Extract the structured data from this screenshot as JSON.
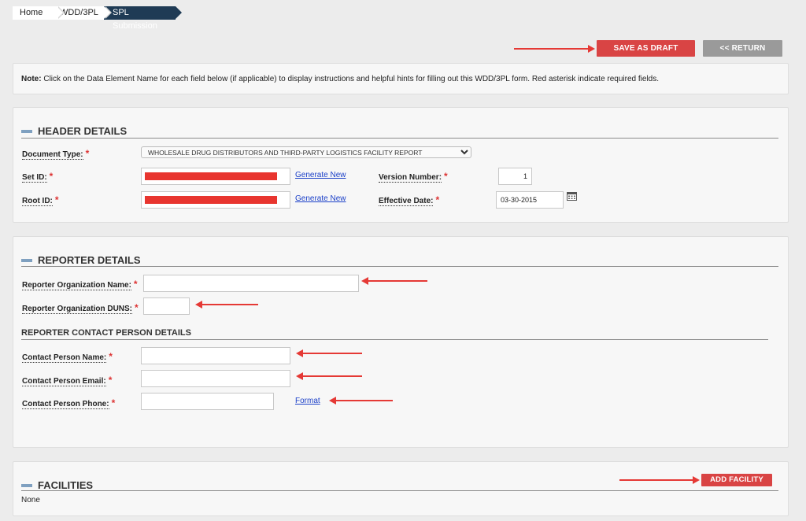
{
  "breadcrumb": [
    "Home",
    "WDD/3PL",
    "SPL Submission"
  ],
  "toolbar": {
    "save_draft": "SAVE AS DRAFT",
    "return": "<< RETURN"
  },
  "note": {
    "bold": "Note:",
    "text": " Click on the Data Element Name for each field below (if applicable) to display instructions and helpful hints for filling out this WDD/3PL form. Red asterisk indicate required fields."
  },
  "header_details": {
    "title": "HEADER DETAILS",
    "document_type_label": "Document Type:",
    "document_type_value": "WHOLESALE DRUG DISTRIBUTORS AND THIRD-PARTY LOGISTICS FACILITY REPORT",
    "set_id_label": "Set ID:",
    "root_id_label": "Root ID:",
    "generate_new": "Generate New",
    "version_label": "Version Number:",
    "version_value": "1",
    "effective_label": "Effective Date:",
    "effective_value": "03-30-2015",
    "required": "*"
  },
  "reporter_details": {
    "title": "REPORTER DETAILS",
    "org_name_label": "Reporter Organization Name:",
    "org_duns_label": "Reporter Organization DUNS:",
    "contact_title": "REPORTER CONTACT PERSON DETAILS",
    "contact_name_label": "Contact Person Name:",
    "contact_email_label": "Contact Person Email:",
    "contact_phone_label": "Contact Person Phone:",
    "format_link": "Format"
  },
  "facilities": {
    "title": "FACILITIES",
    "add_button": "ADD FACILITY",
    "empty_text": "None"
  },
  "colors": {
    "accent_red": "#d94444",
    "annotation_arrow": "#e53935",
    "breadcrumb_active": "#1f3b55",
    "link": "#1a3fc8"
  },
  "icons": {
    "section_collapse": "minus-icon",
    "calendar": "calendar-icon"
  }
}
